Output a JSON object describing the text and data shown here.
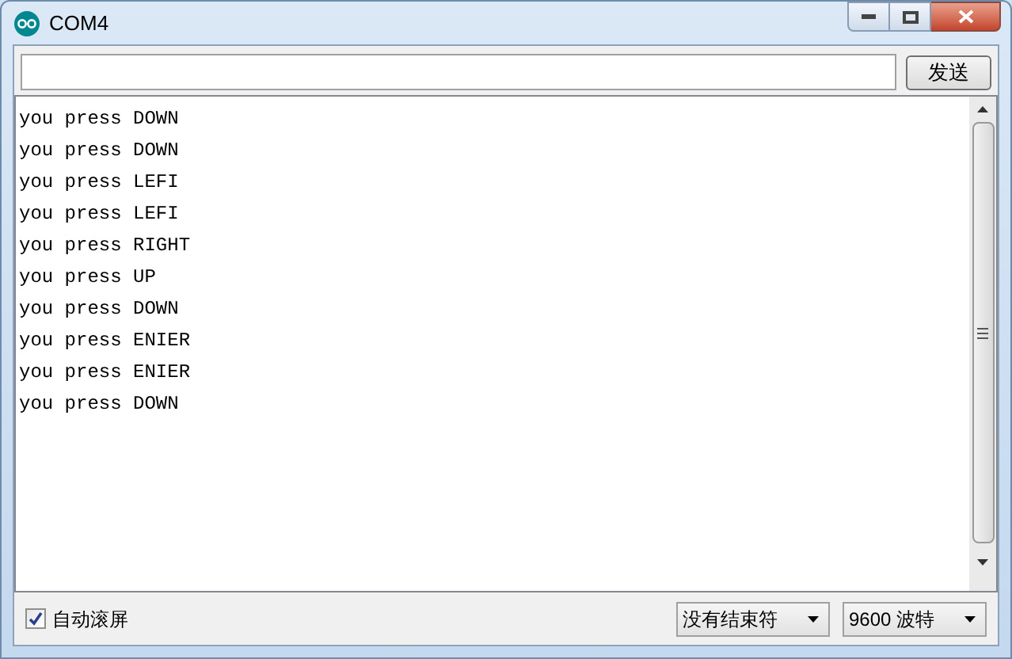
{
  "window": {
    "title": "COM4"
  },
  "send": {
    "button": "发送"
  },
  "output": [
    "you press DOWN",
    "you press DOWN",
    "you press LEFI",
    "you press LEFI",
    "you press RIGHT",
    "you press UP",
    "you press DOWN",
    "you press ENIER",
    "you press ENIER",
    "you press DOWN"
  ],
  "autoscroll": {
    "label": "自动滚屏",
    "checked": true
  },
  "line_ending": {
    "value": "没有结束符"
  },
  "baud": {
    "value": "9600 波特"
  }
}
